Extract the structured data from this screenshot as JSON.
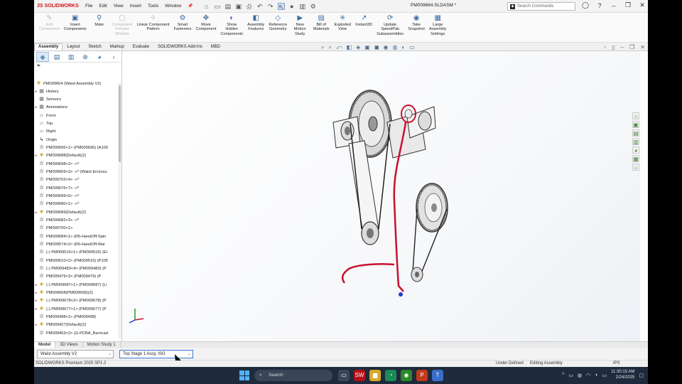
{
  "app": {
    "logo_text": "SOLIDWORKS",
    "document_title": "PM009664.SLDASM *",
    "menu": [
      "File",
      "Edit",
      "View",
      "Insert",
      "Tools",
      "Window"
    ],
    "search_placeholder": "Search Commands"
  },
  "command_manager": [
    {
      "label": "Edit\nComponent",
      "icon": "edit-component-icon",
      "disabled": true
    },
    {
      "label": "Insert\nComponents",
      "icon": "insert-components-icon",
      "disabled": false
    },
    {
      "label": "Mate",
      "icon": "mate-icon",
      "disabled": false
    },
    {
      "label": "Component\nPreview\nWindow",
      "icon": "component-preview-icon",
      "disabled": true
    },
    {
      "label": "Linear Component\nPattern",
      "icon": "linear-pattern-icon",
      "disabled": false
    },
    {
      "label": "Smart\nFasteners",
      "icon": "smart-fasteners-icon",
      "disabled": false
    },
    {
      "label": "Move\nComponent",
      "icon": "move-component-icon",
      "disabled": false
    },
    {
      "label": "Show\nHidden\nComponents",
      "icon": "show-hidden-icon",
      "disabled": false
    },
    {
      "label": "Assembly\nFeatures",
      "icon": "assembly-features-icon",
      "disabled": false
    },
    {
      "label": "Reference\nGeometry",
      "icon": "reference-geometry-icon",
      "disabled": false
    },
    {
      "label": "New\nMotion\nStudy",
      "icon": "motion-study-icon",
      "disabled": false
    },
    {
      "label": "Bill of\nMaterials",
      "icon": "bom-icon",
      "disabled": false
    },
    {
      "label": "Exploded\nView",
      "icon": "exploded-view-icon",
      "disabled": false
    },
    {
      "label": "Instant3D",
      "icon": "instant3d-icon",
      "disabled": false
    },
    {
      "label": "Update\nSpeedPak\nSubassemblies",
      "icon": "speedpak-icon",
      "disabled": false
    },
    {
      "label": "Take\nSnapshot",
      "icon": "snapshot-icon",
      "disabled": false
    },
    {
      "label": "Large\nAssembly\nSettings",
      "icon": "large-assembly-icon",
      "disabled": false
    }
  ],
  "command_tabs": [
    "Assembly",
    "Layout",
    "Sketch",
    "Markup",
    "Evaluate",
    "SOLIDWORKS Add-Ins",
    "MBD"
  ],
  "active_command_tab": "Assembly",
  "tree": {
    "root": "PM009664 (Waist Assembly V2)",
    "items": [
      {
        "label": "History",
        "icon": "history-icon",
        "expand": true,
        "kind": "folder"
      },
      {
        "label": "Sensors",
        "icon": "sensors-icon",
        "expand": false,
        "kind": "folder"
      },
      {
        "label": "Annotations",
        "icon": "annotations-icon",
        "expand": true,
        "kind": "folder"
      },
      {
        "label": "Front",
        "icon": "plane-icon",
        "expand": false,
        "kind": "plane"
      },
      {
        "label": "Top",
        "icon": "plane-icon",
        "expand": false,
        "kind": "plane"
      },
      {
        "label": "Right",
        "icon": "plane-icon",
        "expand": false,
        "kind": "plane"
      },
      {
        "label": "Origin",
        "icon": "origin-icon",
        "expand": false,
        "kind": "origin"
      },
      {
        "label": "PM009696<1> (PM009696) (A100",
        "icon": "part-icon",
        "expand": false,
        "kind": "part"
      },
      {
        "label": "PM009688(Default)(2)",
        "icon": "assembly-icon",
        "expand": true,
        "kind": "asm"
      },
      {
        "label": "PM009698<2> ->*",
        "icon": "part-icon",
        "expand": false,
        "kind": "part"
      },
      {
        "label": "PM009669<3> ->* (Waist Enclosu",
        "icon": "part-icon",
        "expand": false,
        "kind": "part"
      },
      {
        "label": "PM009702<4> ->*",
        "icon": "part-icon",
        "expand": false,
        "kind": "part"
      },
      {
        "label": "PM009676<7> ->*",
        "icon": "part-icon",
        "expand": false,
        "kind": "part"
      },
      {
        "label": "PM009699<5> ->*",
        "icon": "part-icon",
        "expand": false,
        "kind": "part"
      },
      {
        "label": "PM009680<1> ->*",
        "icon": "part-icon",
        "expand": false,
        "kind": "part"
      },
      {
        "label": "PM009689(Default)(2)",
        "icon": "assembly-icon",
        "expand": true,
        "kind": "asm"
      },
      {
        "label": "PM009682<3> ->*",
        "icon": "part-icon",
        "expand": false,
        "kind": "part"
      },
      {
        "label": "PM009700<1>",
        "icon": "part-icon",
        "expand": false,
        "kind": "part"
      },
      {
        "label": "PM009684<1> (R5-HandOff-Spin",
        "icon": "part-icon",
        "expand": false,
        "kind": "part"
      },
      {
        "label": "PM009574<2> (R5-HandOff-Wai",
        "icon": "part-icon",
        "expand": false,
        "kind": "part"
      },
      {
        "label": "(-) PM009516<1> (PM009516) (El",
        "icon": "part-icon",
        "expand": false,
        "kind": "part"
      },
      {
        "label": "PM009510<2> (PM009510) (P105",
        "icon": "part-icon",
        "expand": false,
        "kind": "part"
      },
      {
        "label": "(-) PM009483<4> (PM009483) (P",
        "icon": "part-icon",
        "expand": false,
        "kind": "part"
      },
      {
        "label": "PM009479<3> (PM009479) (P",
        "icon": "part-icon",
        "expand": false,
        "kind": "part"
      },
      {
        "label": "(-) PM009687<1> (PM009687) (Li",
        "icon": "assembly-icon",
        "expand": true,
        "kind": "asm"
      },
      {
        "label": "PM009668(PM009668)(2)",
        "icon": "assembly-icon",
        "expand": true,
        "kind": "asm"
      },
      {
        "label": "(-) PM009678<2> (PM009678) (P",
        "icon": "assembly-icon",
        "expand": true,
        "kind": "asm"
      },
      {
        "label": "(-) PM009677<1> (PM009677) (P",
        "icon": "assembly-icon",
        "expand": true,
        "kind": "asm"
      },
      {
        "label": "PM009498<1> (PM009498)",
        "icon": "part-icon",
        "expand": false,
        "kind": "part"
      },
      {
        "label": "PM009427(Default)(2)",
        "icon": "assembly-icon",
        "expand": true,
        "kind": "asm"
      },
      {
        "label": "PM009453<2> (G-PCBA_Barricad",
        "icon": "part-icon",
        "expand": false,
        "kind": "part"
      }
    ]
  },
  "bottom_tabs": [
    "Model",
    "3D Views",
    "Motion Study 1"
  ],
  "active_bottom_tab": "Model",
  "config": {
    "configuration": "Waist Assembly V2",
    "display_state": "Top Stage 1 Assy, ISO"
  },
  "status": {
    "version": "SOLIDWORKS Premium 2025 SP1.2",
    "defined": "Under Defined",
    "mode": "Editing Assembly",
    "units": "IPS"
  },
  "taskbar": {
    "search_label": "Search",
    "time": "11:30:15 AM",
    "date": "2/24/2025"
  },
  "colors": {
    "brand_red": "#d0141c",
    "belt_red": "#c8102e",
    "accent_blue": "#3a78c8"
  }
}
